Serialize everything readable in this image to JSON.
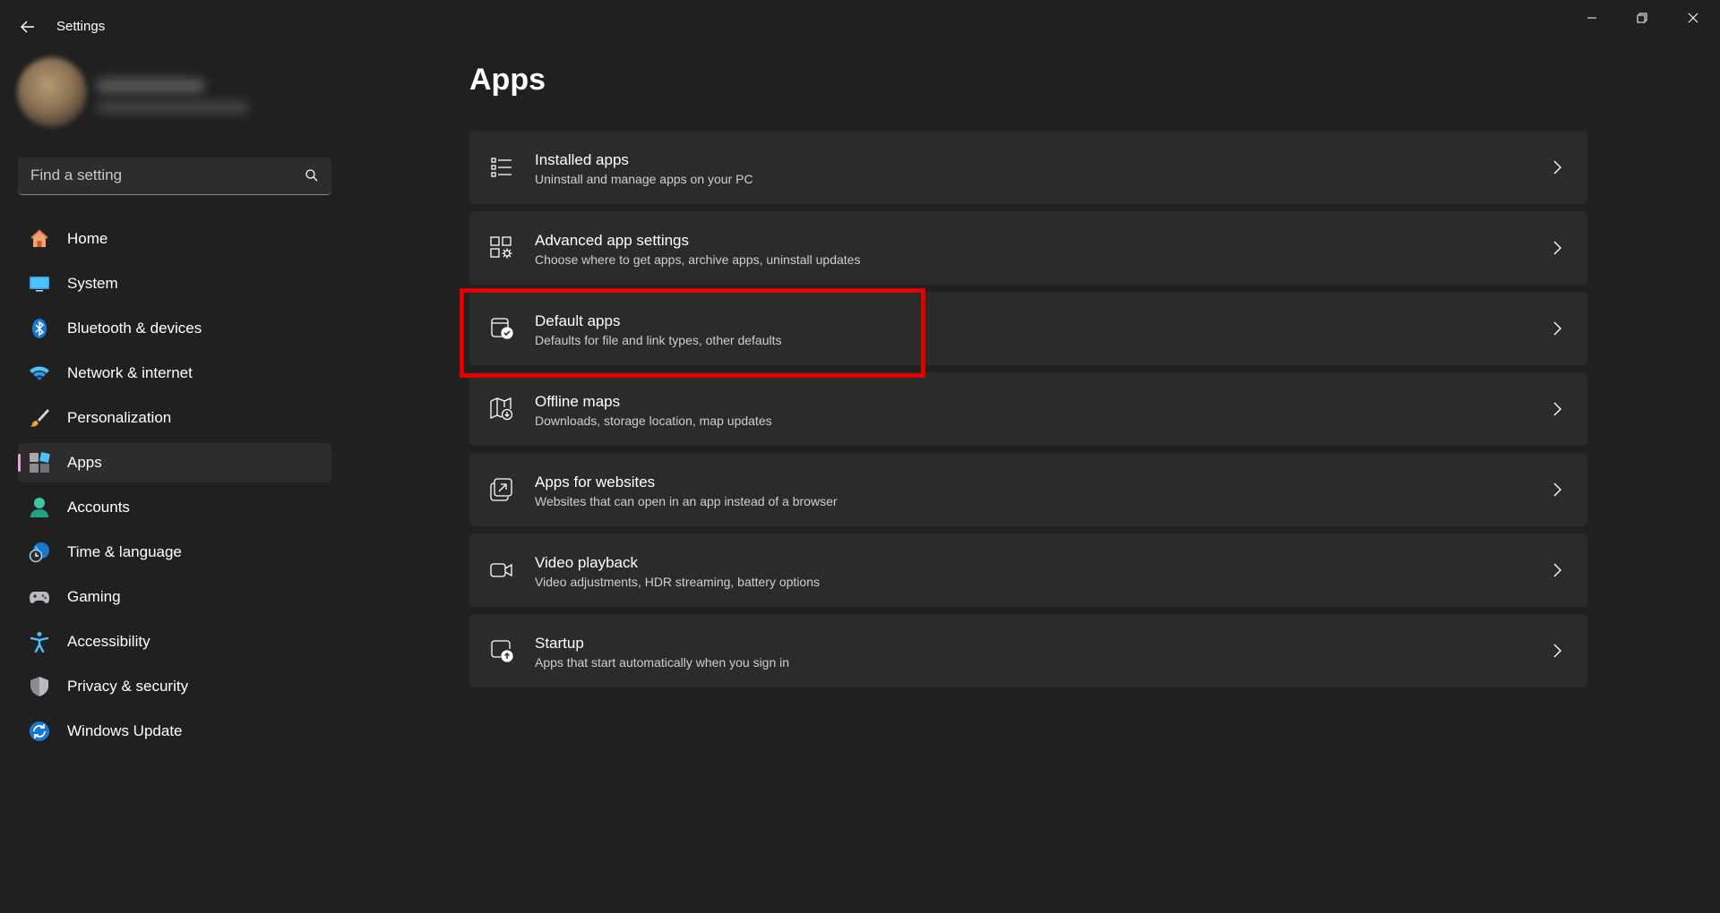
{
  "window": {
    "title": "Settings",
    "controls": [
      "minimize-icon",
      "restore-icon",
      "close-icon"
    ]
  },
  "search": {
    "placeholder": "Find a setting"
  },
  "sidebar": {
    "items": [
      {
        "label": "Home",
        "icon": "home-icon",
        "selected": false
      },
      {
        "label": "System",
        "icon": "system-icon",
        "selected": false
      },
      {
        "label": "Bluetooth & devices",
        "icon": "bluetooth-icon",
        "selected": false
      },
      {
        "label": "Network & internet",
        "icon": "wifi-icon",
        "selected": false
      },
      {
        "label": "Personalization",
        "icon": "brush-icon",
        "selected": false
      },
      {
        "label": "Apps",
        "icon": "apps-icon",
        "selected": true
      },
      {
        "label": "Accounts",
        "icon": "accounts-icon",
        "selected": false
      },
      {
        "label": "Time & language",
        "icon": "time-language-icon",
        "selected": false
      },
      {
        "label": "Gaming",
        "icon": "gamepad-icon",
        "selected": false
      },
      {
        "label": "Accessibility",
        "icon": "accessibility-icon",
        "selected": false
      },
      {
        "label": "Privacy & security",
        "icon": "shield-icon",
        "selected": false
      },
      {
        "label": "Windows Update",
        "icon": "update-icon",
        "selected": false
      }
    ]
  },
  "main": {
    "title": "Apps",
    "cards": [
      {
        "title": "Installed apps",
        "subtitle": "Uninstall and manage apps on your PC",
        "icon": "list-icon"
      },
      {
        "title": "Advanced app settings",
        "subtitle": "Choose where to get apps, archive apps, uninstall updates",
        "icon": "app-settings-icon"
      },
      {
        "title": "Default apps",
        "subtitle": "Defaults for file and link types, other defaults",
        "icon": "default-apps-icon"
      },
      {
        "title": "Offline maps",
        "subtitle": "Downloads, storage location, map updates",
        "icon": "map-icon"
      },
      {
        "title": "Apps for websites",
        "subtitle": "Websites that can open in an app instead of a browser",
        "icon": "open-external-icon"
      },
      {
        "title": "Video playback",
        "subtitle": "Video adjustments, HDR streaming, battery options",
        "icon": "video-icon"
      },
      {
        "title": "Startup",
        "subtitle": "Apps that start automatically when you sign in",
        "icon": "startup-icon"
      }
    ]
  },
  "colors": {
    "background": "#202020",
    "card": "#2b2b2b",
    "selected_nav": "#2d2d2d",
    "accent_indicator": "#e8a0d8",
    "highlight": "#e00000"
  }
}
